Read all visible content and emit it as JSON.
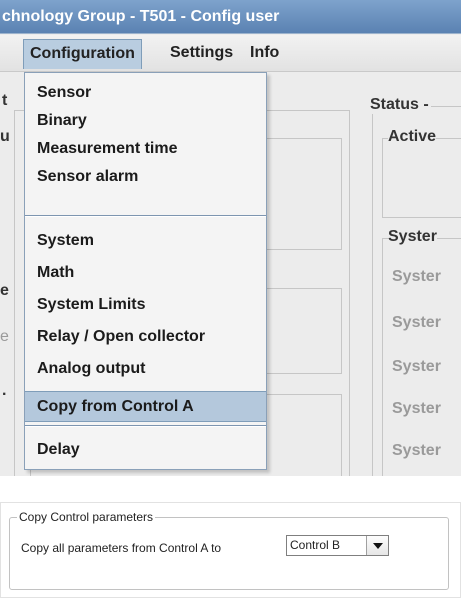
{
  "window": {
    "title": "chnology Group - T501 - Config user"
  },
  "menubar": {
    "items": [
      "Configuration",
      "Settings",
      "Info"
    ]
  },
  "background": {
    "left_fragments": [
      "t",
      "u",
      "e",
      "e",
      "."
    ],
    "status_label": "Status -",
    "active_label": "Active",
    "system_label": "Syster",
    "system_rows": [
      "Syster",
      "Syster",
      "Syster",
      "Syster",
      "Syster"
    ]
  },
  "dropdown": {
    "groups": [
      [
        "Sensor",
        "Binary",
        "Measurement time",
        "Sensor alarm"
      ],
      [
        "System",
        "Math",
        "System Limits",
        "Relay / Open collector",
        "Analog output",
        "Copy from Control A"
      ],
      [
        "Delay"
      ]
    ],
    "highlighted": "Copy from Control A"
  },
  "dialog": {
    "legend": "Copy Control parameters",
    "label": "Copy all parameters from Control A to",
    "selected": "Control B"
  },
  "colors": {
    "titlebar": "#6a8fbf",
    "highlight": "#b4c8dc",
    "separator": "#7d95b0"
  }
}
